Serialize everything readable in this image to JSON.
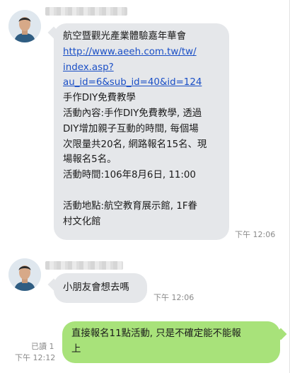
{
  "messages": [
    {
      "direction": "incoming",
      "lines": [
        {
          "text": "航空暨觀光產業體驗嘉年華會",
          "link": false
        },
        {
          "text": "http://www.aeeh.com.tw/tw/",
          "link": true
        },
        {
          "text": "index.asp?",
          "link": true
        },
        {
          "text": "au_id=6&sub_id=40&id=124",
          "link": true
        },
        {
          "text": "手作DIY免費教學",
          "link": false
        },
        {
          "text": "活動內容:手作DIY免費教學, 透過",
          "link": false
        },
        {
          "text": "DIY增加親子互動的時間, 每個場",
          "link": false
        },
        {
          "text": "次限量共20名, 網路報名15名、現",
          "link": false
        },
        {
          "text": "場報名5名。",
          "link": false
        },
        {
          "text": "活動時間:106年8月6日, 11:00",
          "link": false
        },
        {
          "text": "",
          "link": false
        },
        {
          "text": "活動地點:航空教育展示館, 1F眷",
          "link": false
        },
        {
          "text": "村文化館",
          "link": false
        }
      ],
      "time": "下午 12:06"
    },
    {
      "direction": "incoming",
      "lines": [
        {
          "text": "小朋友會想去嗎",
          "link": false
        }
      ],
      "time": "下午 12:06"
    },
    {
      "direction": "outgoing",
      "lines": [
        {
          "text": "直接報名11點活動, 只是不確定能不能報",
          "link": false
        },
        {
          "text": "上",
          "link": false
        }
      ],
      "read": "已讀 1",
      "time": "下午 12:12"
    }
  ],
  "colors": {
    "incoming_bubble": "#e5e7ea",
    "outgoing_bubble": "#a8e27a",
    "link": "#1a4fc6",
    "timestamp": "#8a8a8a"
  },
  "icons": {
    "avatar": "user-avatar-photo"
  }
}
